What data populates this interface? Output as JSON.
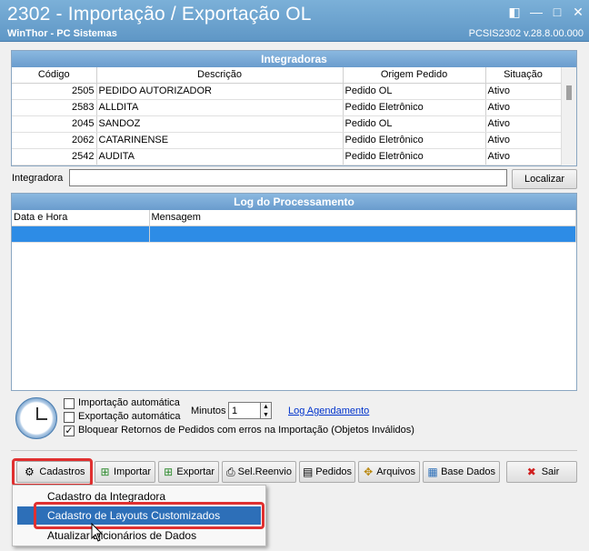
{
  "window": {
    "title": "2302 - Importação / Exportação OL",
    "subtitle": "WinThor - PC Sistemas",
    "version": "PCSIS2302  v.28.8.00.000"
  },
  "integradoras": {
    "header": "Integradoras",
    "columns": [
      "Código",
      "Descrição",
      "Origem Pedido",
      "Situação"
    ],
    "rows": [
      [
        "2505",
        "PEDIDO AUTORIZADOR",
        "Pedido OL",
        "Ativo"
      ],
      [
        "2583",
        "ALLDITA",
        "Pedido Eletrônico",
        "Ativo"
      ],
      [
        "2045",
        "SANDOZ",
        "Pedido OL",
        "Ativo"
      ],
      [
        "2062",
        "CATARINENSE",
        "Pedido Eletrônico",
        "Ativo"
      ],
      [
        "2542",
        "AUDITA",
        "Pedido Eletrônico",
        "Ativo"
      ]
    ]
  },
  "search": {
    "label": "Integradora",
    "value": "",
    "button": "Localizar"
  },
  "log": {
    "header": "Log do Processamento",
    "columns": [
      "Data e Hora",
      "Mensagem"
    ]
  },
  "options": {
    "import_auto": "Importação automática",
    "export_auto": "Exportação automática",
    "block_returns": "Bloquear Retornos de Pedidos com erros na Importação (Objetos Inválidos)",
    "minutes_label": "Minutos",
    "minutes_value": "1",
    "schedule_link": "Log Agendamento"
  },
  "toolbar": {
    "cadastros": "Cadastros",
    "importar": "Importar",
    "exportar": "Exportar",
    "sel_reenvio": "Sel.Reenvio",
    "pedidos": "Pedidos",
    "arquivos": "Arquivos",
    "base_dados": "Base Dados",
    "sair": "Sair"
  },
  "menu": {
    "items": [
      "Cadastro da Integradora",
      "Cadastro de Layouts Customizados",
      "Atualizar Dicionários de Dados"
    ]
  },
  "colors": {
    "title_bar": "#6aa2cf",
    "selection": "#2d6fb8",
    "highlight": "#e03030"
  }
}
